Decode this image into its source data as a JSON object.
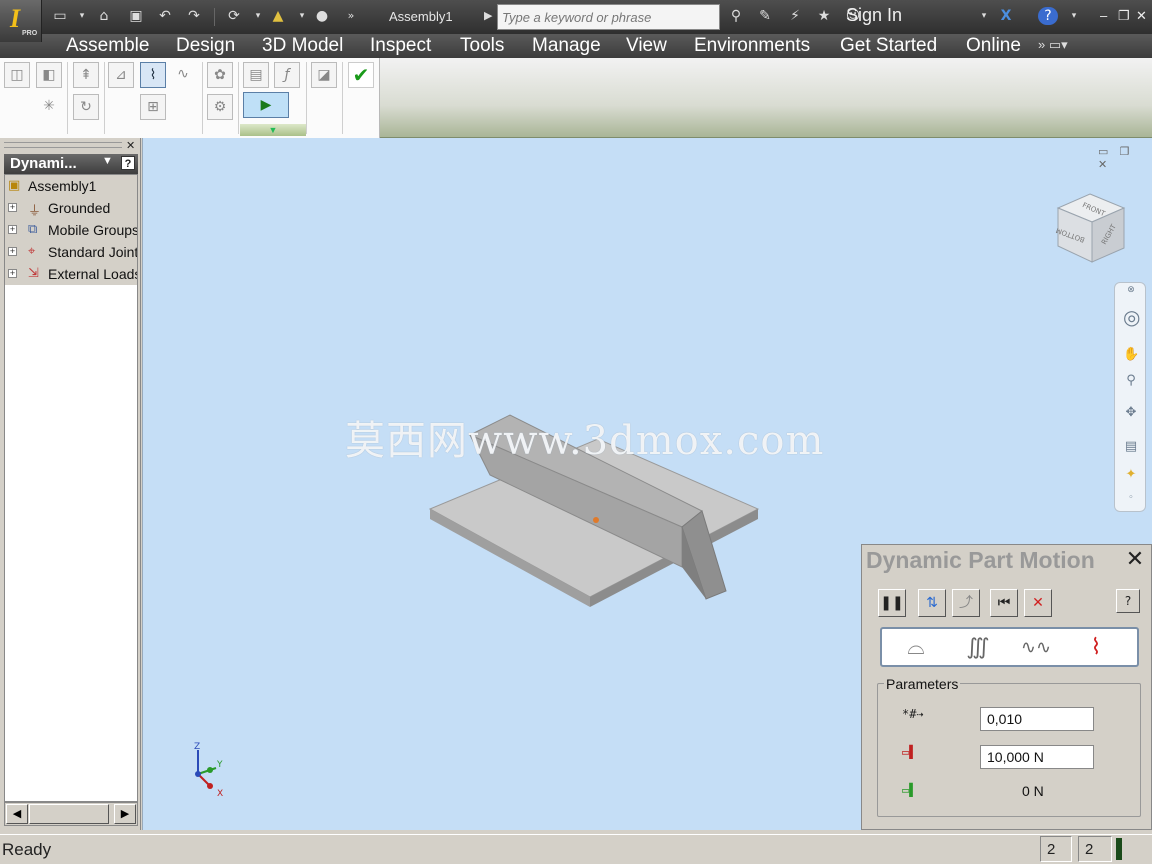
{
  "title_bar": {
    "document_title": "Assembly1",
    "search_placeholder": "Type a keyword or phrase",
    "sign_in_label": "Sign In",
    "app_badge": "PRO"
  },
  "ribbon": {
    "tabs": [
      "Assemble",
      "Design",
      "3D Model",
      "Inspect",
      "Tools",
      "Manage",
      "View",
      "Environments",
      "Get Started",
      "Online"
    ]
  },
  "browser": {
    "header_title": "Dynami...",
    "tree": [
      {
        "label": "Assembly1",
        "icon": "assembly-icon"
      },
      {
        "label": "Grounded",
        "icon": "grounded-icon"
      },
      {
        "label": "Mobile Groups",
        "icon": "mobile-groups-icon"
      },
      {
        "label": "Standard Joints",
        "icon": "standard-joints-icon"
      },
      {
        "label": "External Loads",
        "icon": "external-loads-icon"
      }
    ]
  },
  "viewport": {
    "watermark": "莫西网www.3dmox.com",
    "viewcube_faces": [
      "FRONT",
      "RIGHT",
      "BOTTOM"
    ],
    "triad_axes": [
      "Z",
      "Y",
      "X"
    ]
  },
  "dynamic_part_motion": {
    "title": "Dynamic Part Motion",
    "parameters_label": "Parameters",
    "damping_value": "0,010",
    "max_force_value": "10,000 N",
    "current_force_value": "0 N"
  },
  "status_bar": {
    "status_text": "Ready",
    "count_a": "2",
    "count_b": "2"
  },
  "colors": {
    "viewport_background": "#c5def6",
    "model_face": "#c9c9c9",
    "accent_green": "#1a9a1a"
  }
}
